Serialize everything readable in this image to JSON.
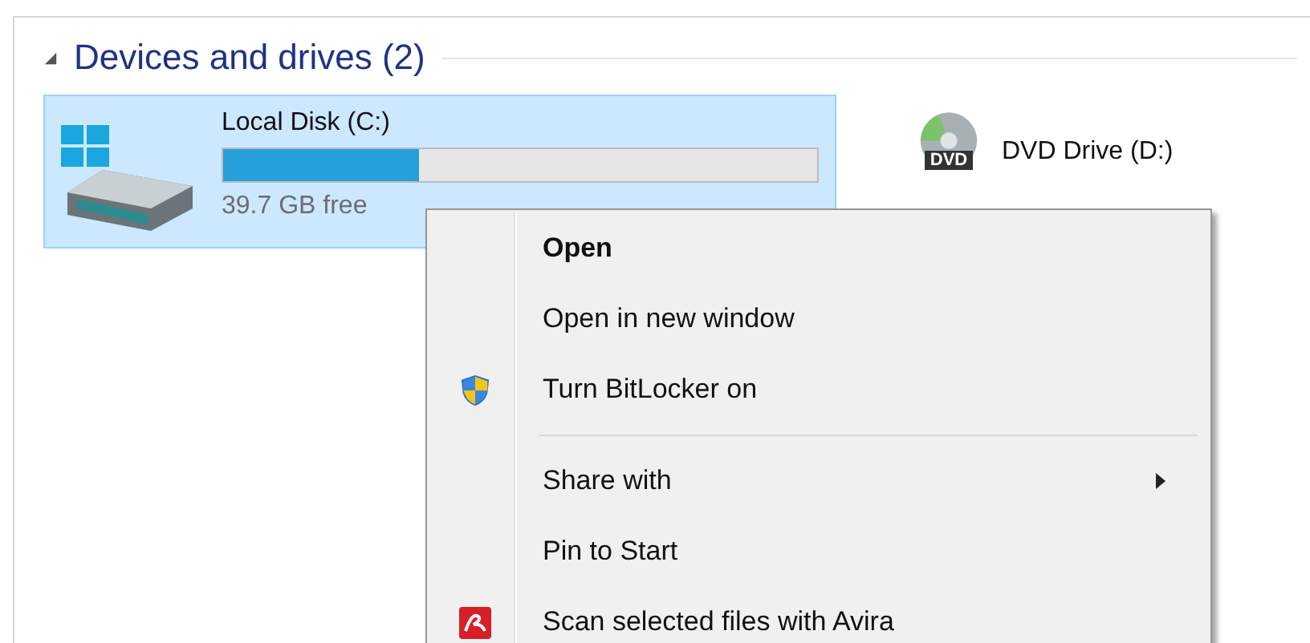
{
  "group": {
    "title": "Devices and drives (2)",
    "expanded": true
  },
  "drives": [
    {
      "name": "Local Disk (C:)",
      "kind": "disk",
      "selected": true,
      "level": 0.33,
      "free": "39.7 GB free"
    },
    {
      "name": "DVD Drive (D:)",
      "kind": "dvd",
      "selected": false,
      "label": "DVD"
    }
  ],
  "context_menu": {
    "items": [
      {
        "kind": "item",
        "label": "Open",
        "default": true,
        "submenu": false
      },
      {
        "kind": "item",
        "label": "Open in new window",
        "default": false,
        "submenu": false
      },
      {
        "kind": "item",
        "label": "Turn BitLocker on",
        "default": false,
        "submenu": false
      },
      {
        "kind": "separator"
      },
      {
        "kind": "item",
        "label": "Share with",
        "default": false,
        "submenu": true
      },
      {
        "kind": "item",
        "label": "Pin to Start",
        "default": false,
        "submenu": false
      },
      {
        "kind": "item",
        "label": "Scan selected files with Avira",
        "default": false,
        "submenu": false
      }
    ]
  }
}
